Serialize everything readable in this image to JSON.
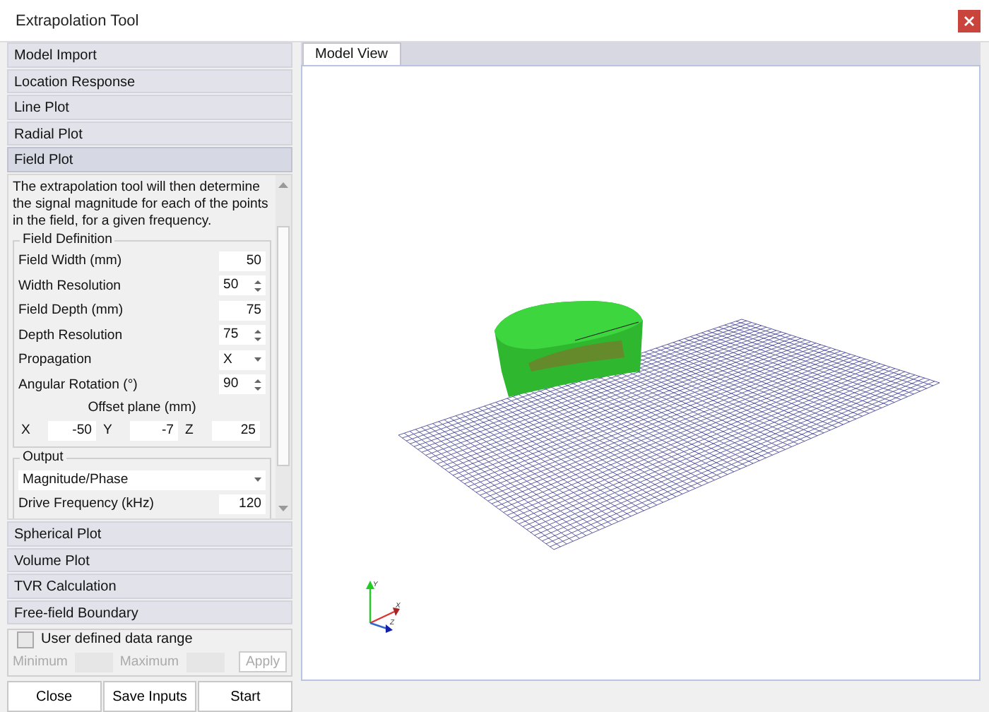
{
  "window": {
    "title": "Extrapolation Tool"
  },
  "sections": [
    {
      "label": "Model Import",
      "expanded": false
    },
    {
      "label": "Location Response",
      "expanded": false
    },
    {
      "label": "Line Plot",
      "expanded": false
    },
    {
      "label": "Radial Plot",
      "expanded": false
    },
    {
      "label": "Field Plot",
      "expanded": true
    },
    {
      "label": "Spherical Plot",
      "expanded": false
    },
    {
      "label": "Volume Plot",
      "expanded": false
    },
    {
      "label": "TVR Calculation",
      "expanded": false
    },
    {
      "label": "Free-field Boundary",
      "expanded": false
    }
  ],
  "field_plot": {
    "description": "The extrapolation tool will then determine the signal magnitude for each of the points in the field, for a given frequency.",
    "field_definition": {
      "title": "Field Definition",
      "rows": [
        {
          "label": "Field Width (mm)",
          "value": "50",
          "kind": "number"
        },
        {
          "label": "Width Resolution",
          "value": "50",
          "kind": "spin"
        },
        {
          "label": "Field Depth (mm)",
          "value": "75",
          "kind": "number"
        },
        {
          "label": "Depth Resolution",
          "value": "75",
          "kind": "spin"
        },
        {
          "label": "Propagation",
          "value": "X",
          "kind": "dropdown"
        },
        {
          "label": "Angular Rotation (°)",
          "value": "90",
          "kind": "spin"
        }
      ],
      "offset_title": "Offset plane (mm)",
      "offset": [
        {
          "axis": "X",
          "value": "-50"
        },
        {
          "axis": "Y",
          "value": "-7"
        },
        {
          "axis": "Z",
          "value": "25"
        }
      ]
    },
    "output": {
      "title": "Output",
      "mode": "Magnitude/Phase",
      "rows": [
        {
          "label": "Drive Frequency (kHz)",
          "value": "120",
          "kind": "number"
        }
      ]
    }
  },
  "data_range": {
    "label": "User defined data range",
    "checked": false,
    "disabled": true,
    "minimum_label": "Minimum",
    "maximum_label": "Maximum",
    "apply": "Apply"
  },
  "buttons": [
    "Close",
    "Save Inputs",
    "Start"
  ],
  "tabs": [
    {
      "label": "Model View",
      "selected": true
    }
  ],
  "axes": {
    "y": "Y",
    "x": "X",
    "z": "Z"
  }
}
